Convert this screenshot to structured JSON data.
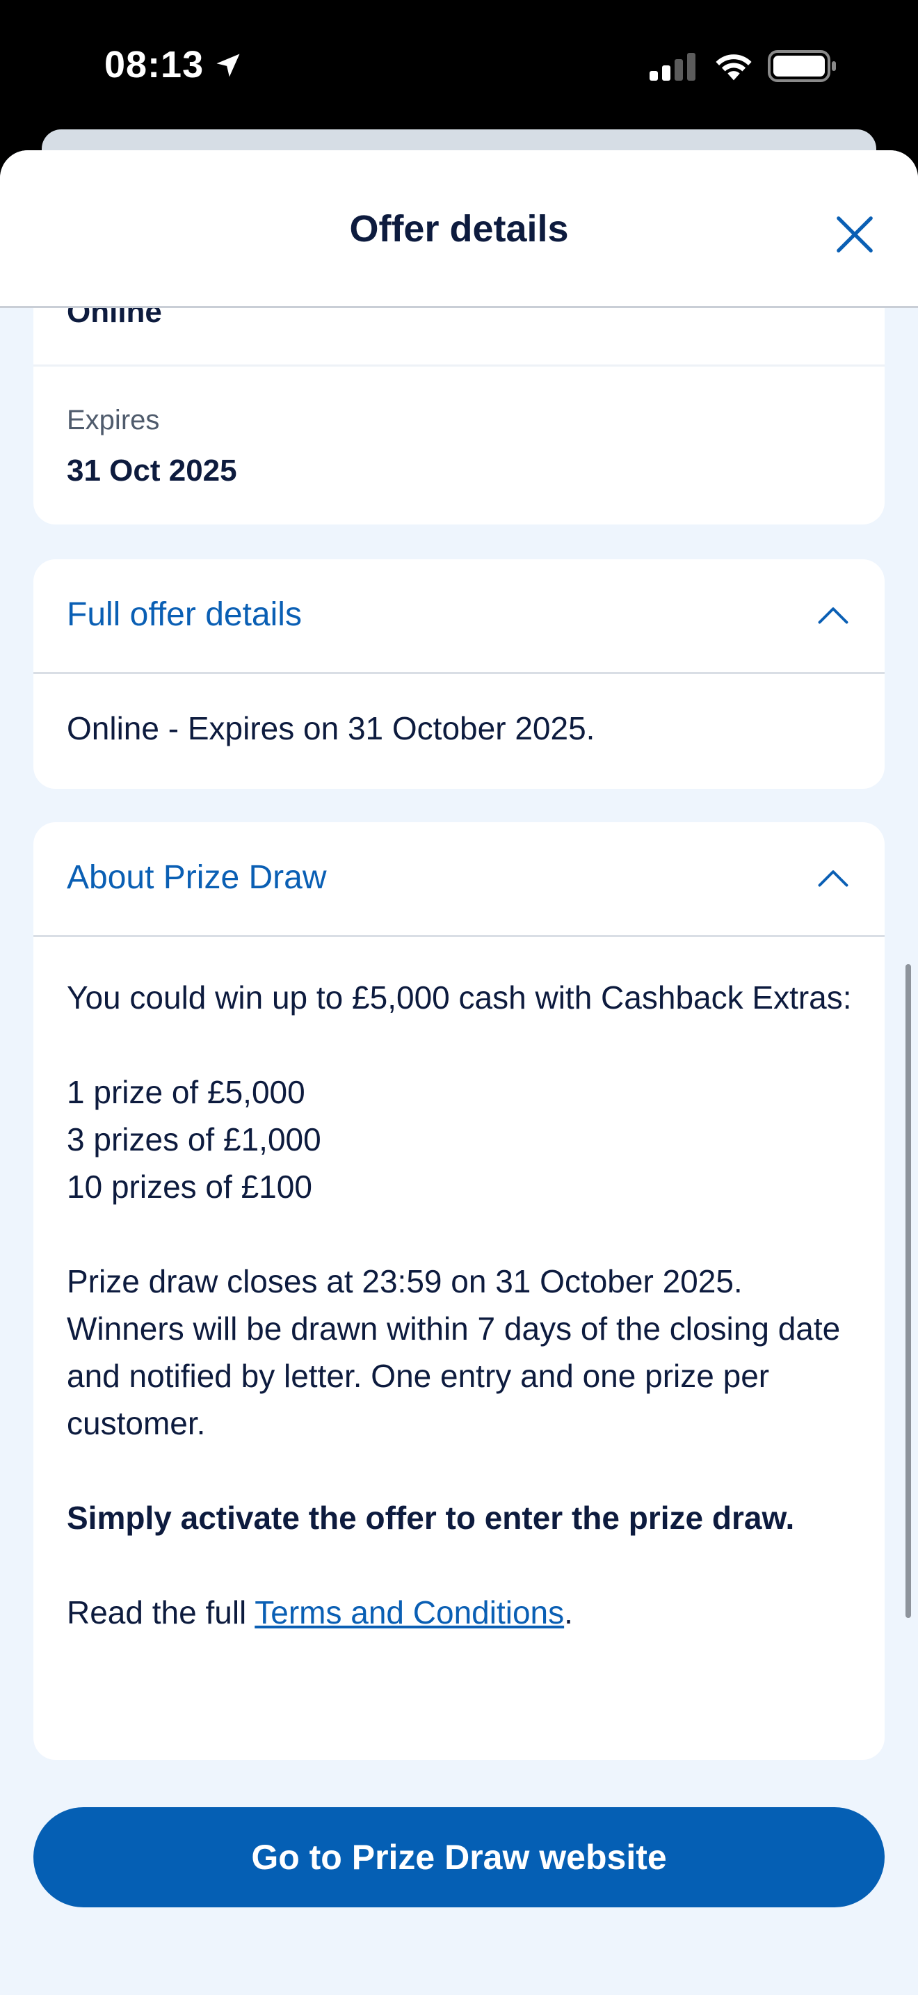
{
  "status_bar": {
    "time": "08:13"
  },
  "header": {
    "title": "Offer details"
  },
  "summary": {
    "channel": "Online",
    "expires_label": "Expires",
    "expires_value": "31 Oct 2025"
  },
  "full_offer": {
    "title": "Full offer details",
    "text": "Online - Expires on 31 October 2025."
  },
  "prize_draw": {
    "title": "About Prize Draw",
    "intro": "You could win up to £5,000 cash with Cashback Extras:",
    "prizes": [
      "1 prize of £5,000",
      "3 prizes of £1,000",
      "10 prizes of £100"
    ],
    "closing": "Prize draw closes at 23:59 on 31 October 2025. Winners will be drawn within 7 days of the closing date and notified by letter. One entry and one prize per customer.",
    "bold_note": "Simply activate the offer to enter the prize draw.",
    "terms_prefix": "Read the full ",
    "terms_link": "Terms and Conditions",
    "terms_suffix": "."
  },
  "cta": {
    "label": "Go to Prize Draw website"
  },
  "colors": {
    "brand_blue": "#055fb4",
    "link_blue": "#0a5fb4",
    "text_dark": "#0d1b3e",
    "background": "#eef5fd"
  }
}
